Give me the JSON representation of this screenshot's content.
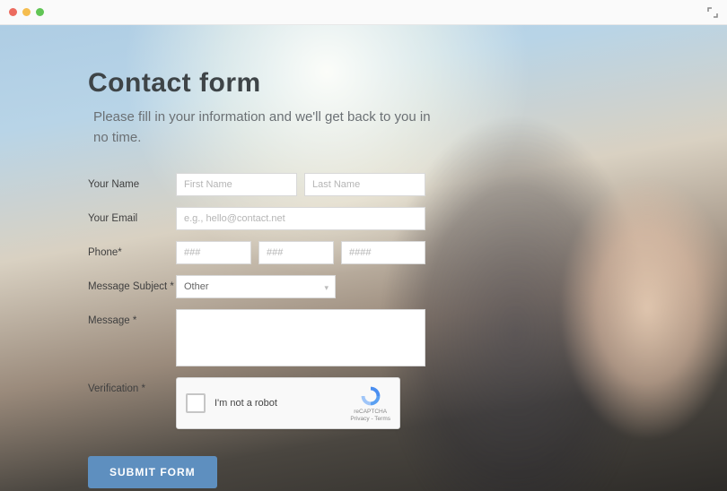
{
  "header": {
    "title": "Contact form",
    "subtitle": "Please fill in your information and we'll get back to you in no time."
  },
  "form": {
    "name": {
      "label": "Your  Name",
      "first_placeholder": "First Name",
      "last_placeholder": "Last Name"
    },
    "email": {
      "label": "Your Email",
      "placeholder": "e.g., hello@contact.net"
    },
    "phone": {
      "label": "Phone*",
      "p1_placeholder": "###",
      "p2_placeholder": "###",
      "p3_placeholder": "####"
    },
    "subject": {
      "label": "Message Subject *",
      "selected": "Other"
    },
    "message": {
      "label": "Message *"
    },
    "verification": {
      "label": "Verification *",
      "recaptcha_text": "I'm not a robot",
      "recaptcha_brand": "reCAPTCHA",
      "recaptcha_terms": "Privacy - Terms"
    },
    "submit_label": "SUBMIT FORM"
  }
}
